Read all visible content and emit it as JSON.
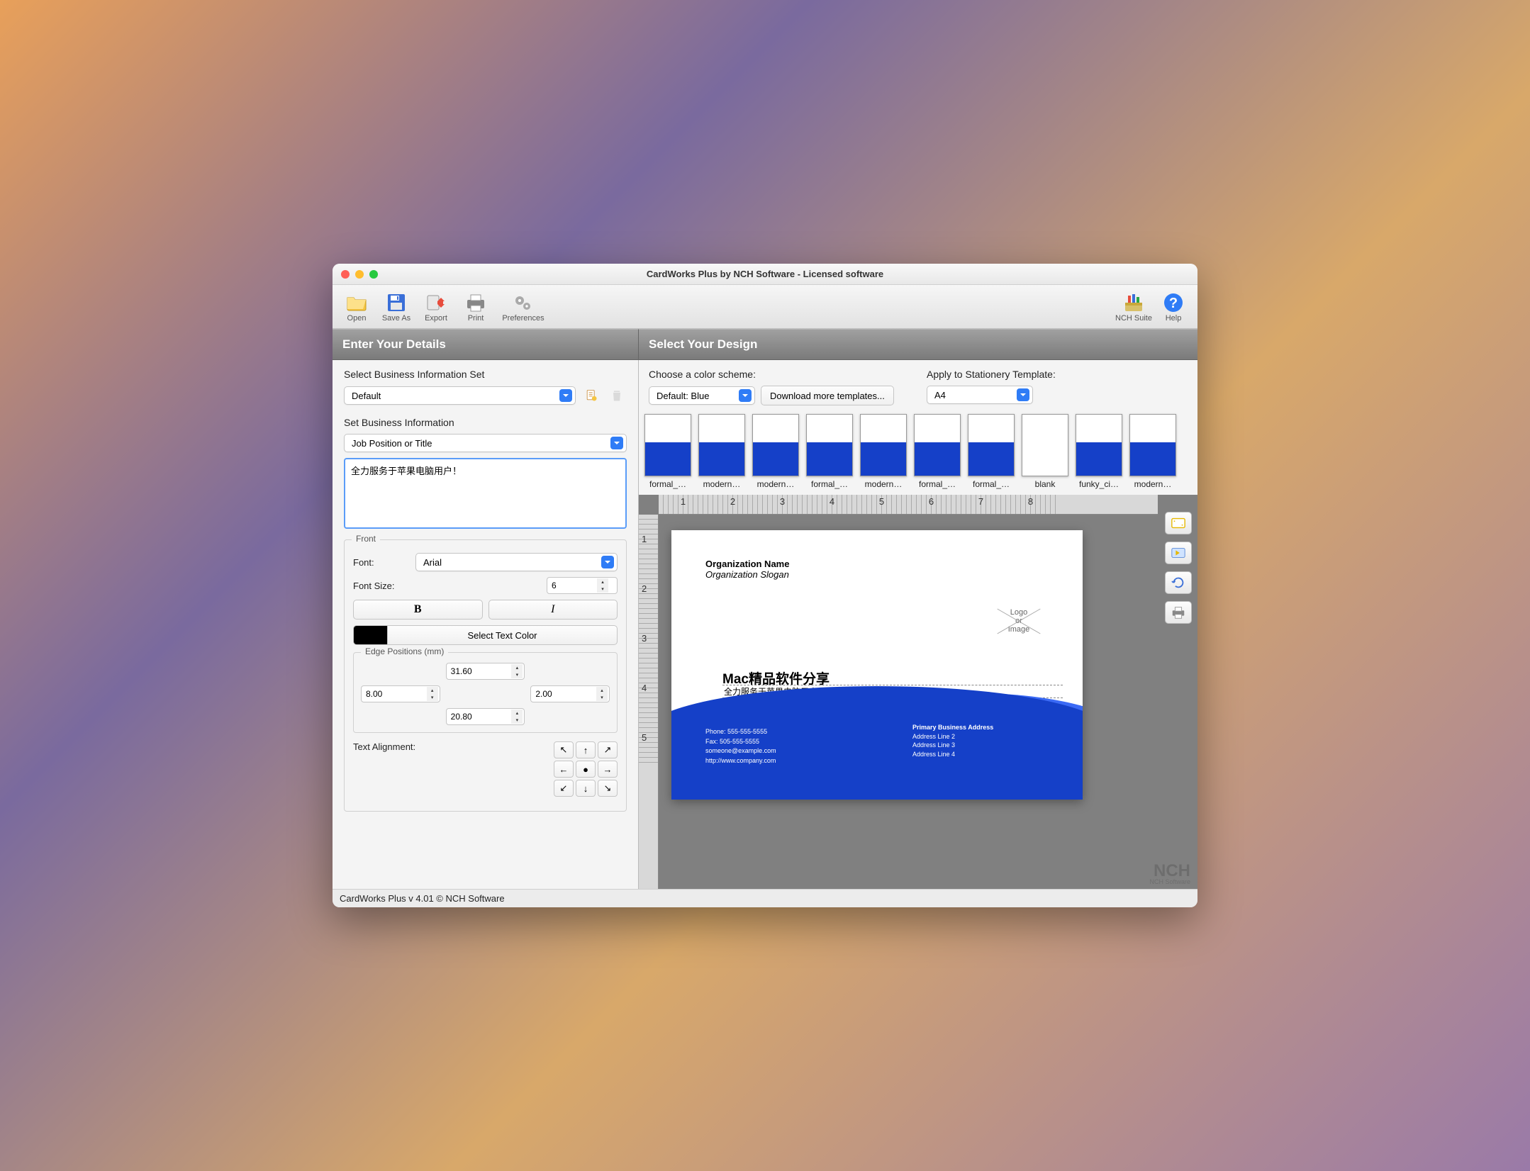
{
  "window": {
    "title": "CardWorks Plus by NCH Software - Licensed software"
  },
  "toolbar": {
    "open": "Open",
    "save_as": "Save As",
    "export": "Export",
    "print": "Print",
    "preferences": "Preferences",
    "nch_suite": "NCH Suite",
    "help": "Help"
  },
  "panes": {
    "left_header": "Enter Your Details",
    "right_header": "Select Your Design"
  },
  "left": {
    "select_set_label": "Select Business Information Set",
    "set_value": "Default",
    "set_biz_label": "Set Business Information",
    "biz_select_value": "Job Position or Title",
    "biz_text": "全力服务于苹果电脑用户！",
    "front_group": "Front",
    "font_label": "Font:",
    "font_value": "Arial",
    "font_size_label": "Font Size:",
    "font_size_value": "6",
    "bold": "B",
    "italic": "I",
    "select_text_color": "Select Text Color",
    "edge_label": "Edge Positions (mm)",
    "edge_top": "31.60",
    "edge_left": "8.00",
    "edge_right": "2.00",
    "edge_bottom": "20.80",
    "text_alignment_label": "Text Alignment:"
  },
  "right": {
    "color_scheme_label": "Choose a color scheme:",
    "color_scheme_value": "Default: Blue",
    "download_templates": "Download more templates...",
    "stationery_label": "Apply to Stationery Template:",
    "stationery_value": "A4",
    "templates": [
      "formal_…",
      "modern…",
      "modern…",
      "formal_…",
      "modern…",
      "formal_…",
      "formal_…",
      "blank",
      "funky_ci…",
      "modern…"
    ],
    "ruler_h": [
      "1",
      "2",
      "3",
      "4",
      "5",
      "6",
      "7",
      "8"
    ],
    "ruler_v": [
      "1",
      "2",
      "3",
      "4",
      "5"
    ]
  },
  "card": {
    "org_name": "Organization Name",
    "org_slogan": "Organization Slogan",
    "logo_text_1": "Logo",
    "logo_text_2": "or",
    "logo_text_3": "Image",
    "big_title": "Mac精品软件分享",
    "sub_title": "全力服务于苹果电脑用户！",
    "phone_label": "Phone: 555-555-5555",
    "fax_label": "Fax: 505-555-5555",
    "email": "someone@example.com",
    "web": "http://www.company.com",
    "addr_primary": "Primary Business Address",
    "addr2": "Address Line 2",
    "addr3": "Address Line 3",
    "addr4": "Address Line 4"
  },
  "watermark": {
    "big": "NCH",
    "small": "NCH Software"
  },
  "statusbar": "CardWorks Plus v 4.01 © NCH Software"
}
